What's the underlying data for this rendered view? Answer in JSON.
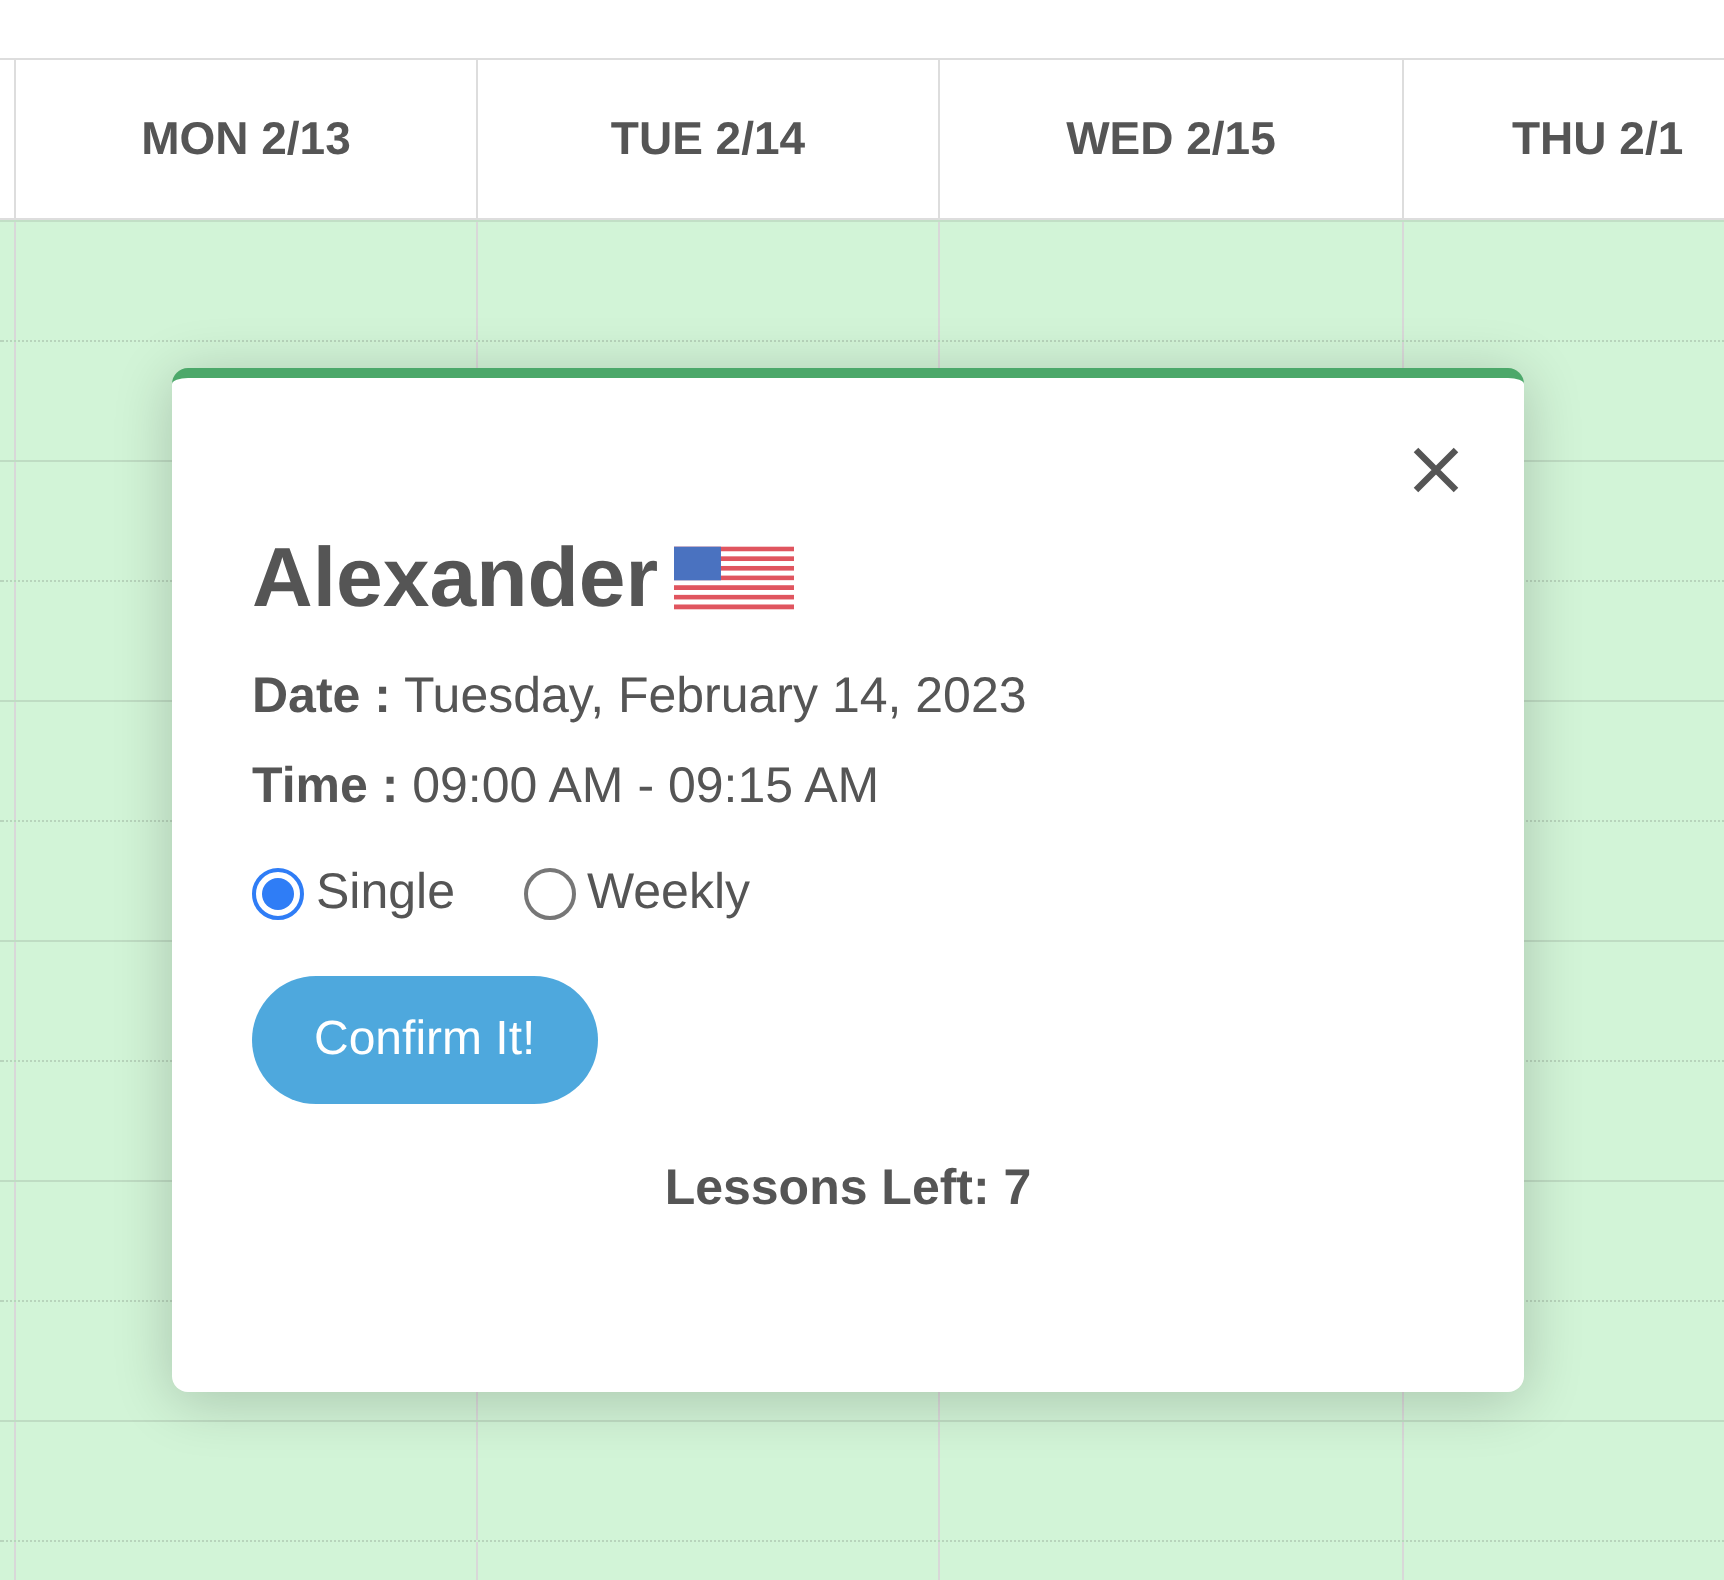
{
  "calendar": {
    "day_headers": [
      "MON 2/13",
      "TUE 2/14",
      "WED 2/15",
      "THU 2/1"
    ]
  },
  "booking_popup": {
    "name": "Alexander",
    "date_label": "Date :",
    "date_value": "Tuesday, February 14, 2023",
    "time_label": "Time :",
    "time_value": "09:00 AM - 09:15 AM",
    "repeat_options": [
      {
        "label": "Single",
        "selected": true
      },
      {
        "label": "Weekly",
        "selected": false
      }
    ],
    "confirm_button": "Confirm It!",
    "lessons_left": "Lessons Left: 7"
  }
}
